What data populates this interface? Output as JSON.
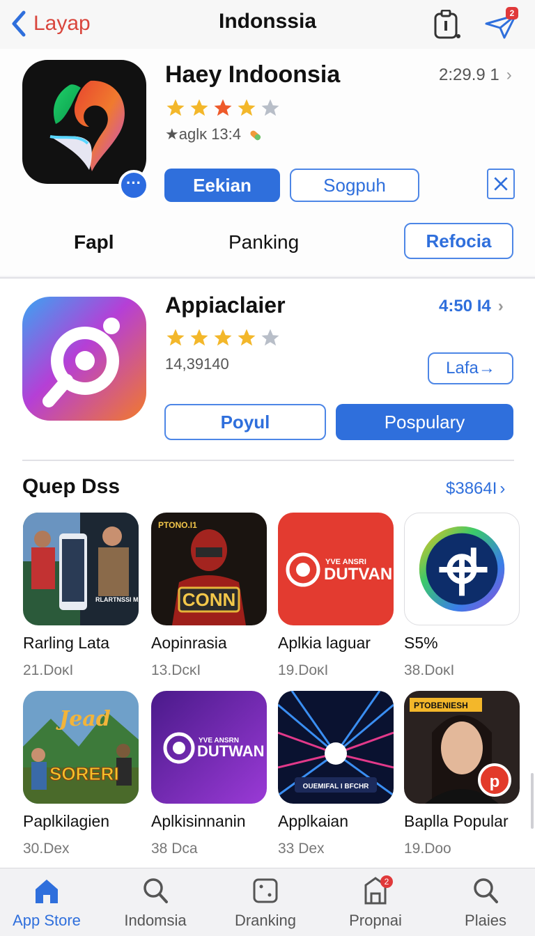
{
  "nav": {
    "back_label": "Layap",
    "title": "Indonssia",
    "send_badge": "2"
  },
  "featured": {
    "title": "Haey Indoonsia",
    "time": "2:29.9 1",
    "rating_stars": 4,
    "meta": "★aglĸ  13:4",
    "primary_button": "Eekian",
    "secondary_button": "Sogpuh",
    "more_badge": "···"
  },
  "tabs_row": {
    "left": "Fapl",
    "middle": "Panking",
    "right_button": "Refocia"
  },
  "second": {
    "title": "Appiaclaier",
    "time": "4:50 I4",
    "rating_stars": 4,
    "count": "14,39140",
    "small_button": "Lafa→",
    "outline_button": "Poyul",
    "primary_button": "Pospulary"
  },
  "section": {
    "title": "Quep Dss",
    "link": "$3864I"
  },
  "grid": [
    {
      "name": "Rarling Lata",
      "size": "21.DoĸI",
      "thumb_text": "RLARTNSSI MAINNRS"
    },
    {
      "name": "Aopinrasia",
      "size": "13.DcĸI",
      "thumb_text": "CONN",
      "thumb_tag": "PTONO.I1"
    },
    {
      "name": "Aplkia laguar",
      "size": "19.DoĸI",
      "thumb_text": "DUTVAN",
      "thumb_sub": "YVE ANSRI"
    },
    {
      "name": "S5%",
      "size": "38.DoĸI",
      "thumb_text": ""
    },
    {
      "name": "Paplkilagien",
      "size": "30.Dex",
      "thumb_text": "SORERI",
      "thumb_tag": "Jead"
    },
    {
      "name": "Aplkisinnanin",
      "size": "38 Dca",
      "thumb_text": "DUTWAN",
      "thumb_sub": "YVE ANSRN"
    },
    {
      "name": "Applkaian",
      "size": "33 Dex",
      "thumb_text": "OUEMIFAL I BFCHR"
    },
    {
      "name": "Baplla Popular",
      "size": "19.Doo",
      "thumb_tag": "PTOBENIESH"
    }
  ],
  "tabbar": [
    {
      "label": "App Store",
      "icon": "home-icon",
      "active": true
    },
    {
      "label": "Indomsia",
      "icon": "search-icon"
    },
    {
      "label": "Dranking",
      "icon": "dice-icon"
    },
    {
      "label": "Propnai",
      "icon": "bookmark-icon",
      "badge": "2"
    },
    {
      "label": "Plaies",
      "icon": "search-icon"
    }
  ],
  "colors": {
    "accent": "#2f6fdc",
    "back_red": "#d9463d",
    "star": "#f3b72a",
    "star_alt": "#ee5a2a",
    "star_empty": "#b8bec8"
  }
}
